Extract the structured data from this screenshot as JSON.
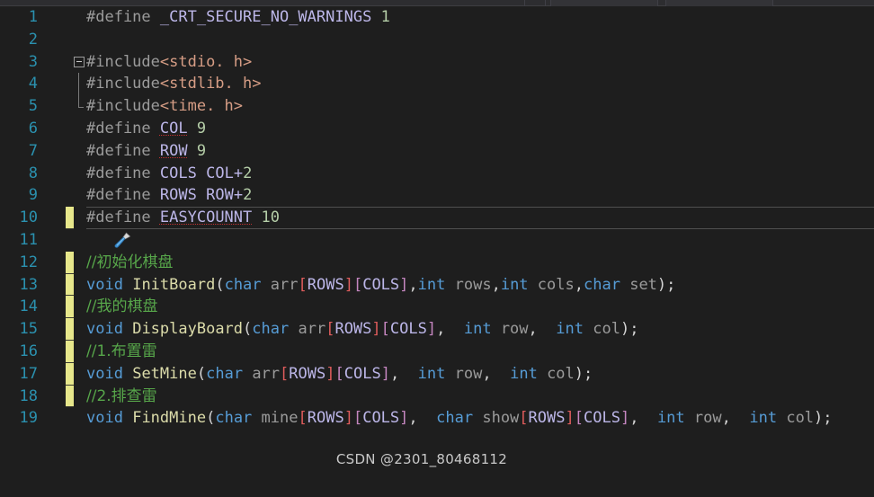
{
  "app": {
    "name": "Visual Studio Code Editor",
    "background_color": "#1e1e1e",
    "language": "C"
  },
  "toolbar": {
    "visible_strip": true
  },
  "gutter": {
    "line_number_color": "#2b91af",
    "change_bar_color": "#e7e78b",
    "quick_action_icon": "screwdriver-icon",
    "change_bar_lines": [
      12,
      13,
      14,
      15,
      16,
      17,
      18
    ]
  },
  "editor": {
    "current_line": 10,
    "first_line": 1,
    "last_line": 19,
    "lines": [
      {
        "n": "1",
        "text": "#define _CRT_SECURE_NO_WARNINGS 1"
      },
      {
        "n": "2",
        "text": ""
      },
      {
        "n": "3",
        "text": "#include<stdio. h>"
      },
      {
        "n": "4",
        "text": "#include<stdlib. h>"
      },
      {
        "n": "5",
        "text": "#include<time. h>"
      },
      {
        "n": "6",
        "text": "#define COL 9"
      },
      {
        "n": "7",
        "text": "#define ROW 9"
      },
      {
        "n": "8",
        "text": "#define COLS COL+2"
      },
      {
        "n": "9",
        "text": "#define ROWS ROW+2"
      },
      {
        "n": "10",
        "text": "#define EASYCOUNNT 10"
      },
      {
        "n": "11",
        "text": ""
      },
      {
        "n": "12",
        "text": "//初始化棋盘"
      },
      {
        "n": "13",
        "text": "void InitBoard(char arr[ROWS][COLS],int rows,int cols,char set);"
      },
      {
        "n": "14",
        "text": "//我的棋盘"
      },
      {
        "n": "15",
        "text": "void DisplayBoard(char arr[ROWS][COLS],  int row,  int col);"
      },
      {
        "n": "16",
        "text": "//1.布置雷"
      },
      {
        "n": "17",
        "text": "void SetMine(char arr[ROWS][COLS],  int row,  int col);"
      },
      {
        "n": "18",
        "text": "//2.排查雷"
      },
      {
        "n": "19",
        "text": "void FindMine(char mine[ROWS][COLS],  char show[ROWS][COLS],  int row,  int col);"
      }
    ],
    "tokens": {
      "define_keyword": "#define",
      "include_keyword": "#include",
      "macros": [
        "_CRT_SECURE_NO_WARNINGS",
        "COL",
        "ROW",
        "COLS",
        "ROWS",
        "EASYCOUNNT"
      ],
      "headers": [
        "<stdio. h>",
        "<stdlib. h>",
        "<time. h>"
      ],
      "keywords": [
        "void",
        "char",
        "int"
      ],
      "functions": [
        "InitBoard",
        "DisplayBoard",
        "SetMine",
        "FindMine"
      ],
      "numbers": [
        "1",
        "9",
        "9",
        "2",
        "2",
        "10"
      ]
    },
    "colors": {
      "preprocessor": "#9b9b9b",
      "macro": "#bcb6e8",
      "number": "#b5cea8",
      "header": "#d69d85",
      "keyword": "#569cd6",
      "function": "#dcdcaa",
      "comment": "#57a64a",
      "bracket_red": "#e05c5c",
      "bracket_magenta": "#c586c0",
      "punctuation": "#d4d4d4"
    }
  },
  "watermark": {
    "text": "CSDN @2301_80468112"
  }
}
